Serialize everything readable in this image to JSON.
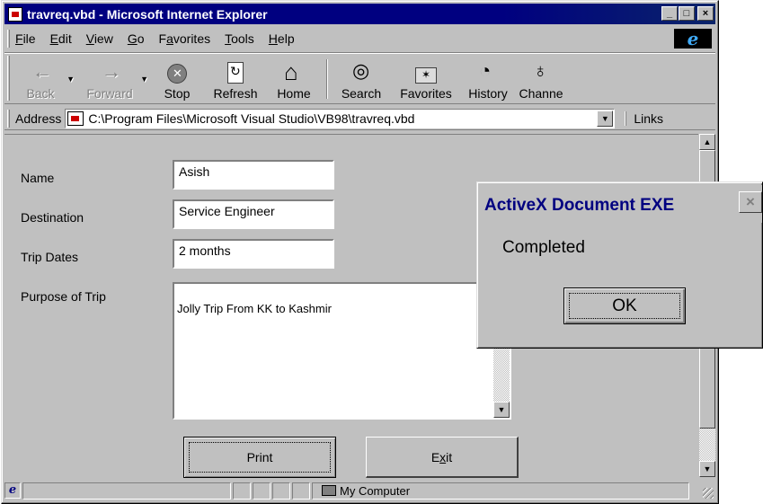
{
  "window": {
    "title": "travreq.vbd - Microsoft Internet Explorer",
    "minimize": "_",
    "maximize": "□",
    "close": "×"
  },
  "menu": [
    {
      "pre": "",
      "key": "F",
      "post": "ile"
    },
    {
      "pre": "",
      "key": "E",
      "post": "dit"
    },
    {
      "pre": "",
      "key": "V",
      "post": "iew"
    },
    {
      "pre": "",
      "key": "G",
      "post": "o"
    },
    {
      "pre": "F",
      "key": "a",
      "post": "vorites"
    },
    {
      "pre": "",
      "key": "T",
      "post": "ools"
    },
    {
      "pre": "",
      "key": "H",
      "post": "elp"
    }
  ],
  "ie_logo": "e",
  "toolbar": {
    "back": "Back",
    "forward": "Forward",
    "stop": "Stop",
    "refresh": "Refresh",
    "home": "Home",
    "search": "Search",
    "favorites": "Favorites",
    "history": "History",
    "channels": "Channe"
  },
  "address": {
    "label": "Address",
    "value": "C:\\Program Files\\Microsoft Visual Studio\\VB98\\travreq.vbd",
    "links": "Links"
  },
  "form": {
    "name_label": "Name",
    "name_value": "Asish",
    "destination_label": "Destination",
    "destination_value": "Service Engineer",
    "trip_dates_label": "Trip Dates",
    "trip_dates_value": "2 months",
    "purpose_label": "Purpose of Trip",
    "purpose_value": "Jolly Trip From KK to Kashmir",
    "print_button": "Print",
    "exit_button_pre": "E",
    "exit_button_key": "x",
    "exit_button_post": "it"
  },
  "status": {
    "icon": "e",
    "zone": "My Computer"
  },
  "dialog": {
    "title": "ActiveX Document EXE",
    "close": "×",
    "message": "Completed",
    "ok": "OK"
  },
  "icons": {
    "window": "window-icon",
    "back": "back-arrow-icon",
    "forward": "forward-arrow-icon",
    "stop": "stop-icon",
    "refresh": "refresh-icon",
    "home": "home-icon",
    "search": "search-globe-icon",
    "favorites": "favorites-folder-icon",
    "history": "history-icon",
    "channels": "channels-icon"
  }
}
